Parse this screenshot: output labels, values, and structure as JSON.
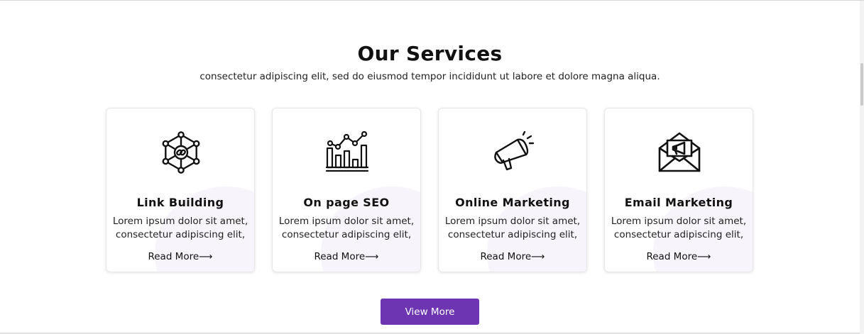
{
  "section": {
    "title": "Our Services",
    "subtitle": "consectetur adipiscing elit, sed do eiusmod tempor incididunt ut labore et dolore magna aliqua."
  },
  "cards": [
    {
      "title": "Link Building",
      "desc_line1": "Lorem ipsum dolor sit amet,",
      "desc_line2": "consectetur adipiscing elit,",
      "link": "Read More⟶",
      "icon": "link-network-icon"
    },
    {
      "title": "On page SEO",
      "desc_line1": "Lorem ipsum dolor sit amet,",
      "desc_line2": "consectetur adipiscing elit,",
      "link": "Read More⟶",
      "icon": "bar-chart-trend-icon"
    },
    {
      "title": "Online Marketing",
      "desc_line1": "Lorem ipsum dolor sit amet,",
      "desc_line2": "consectetur adipiscing elit,",
      "link": "Read More⟶",
      "icon": "megaphone-icon"
    },
    {
      "title": "Email Marketing",
      "desc_line1": "Lorem ipsum dolor sit amet,",
      "desc_line2": "consectetur adipiscing elit,",
      "link": "Read More⟶",
      "icon": "email-envelope-icon"
    }
  ],
  "button": {
    "view_more": "View More"
  },
  "colors": {
    "accent": "#6e35b2",
    "card_blob": "#f7f4fb",
    "text": "#111111"
  }
}
